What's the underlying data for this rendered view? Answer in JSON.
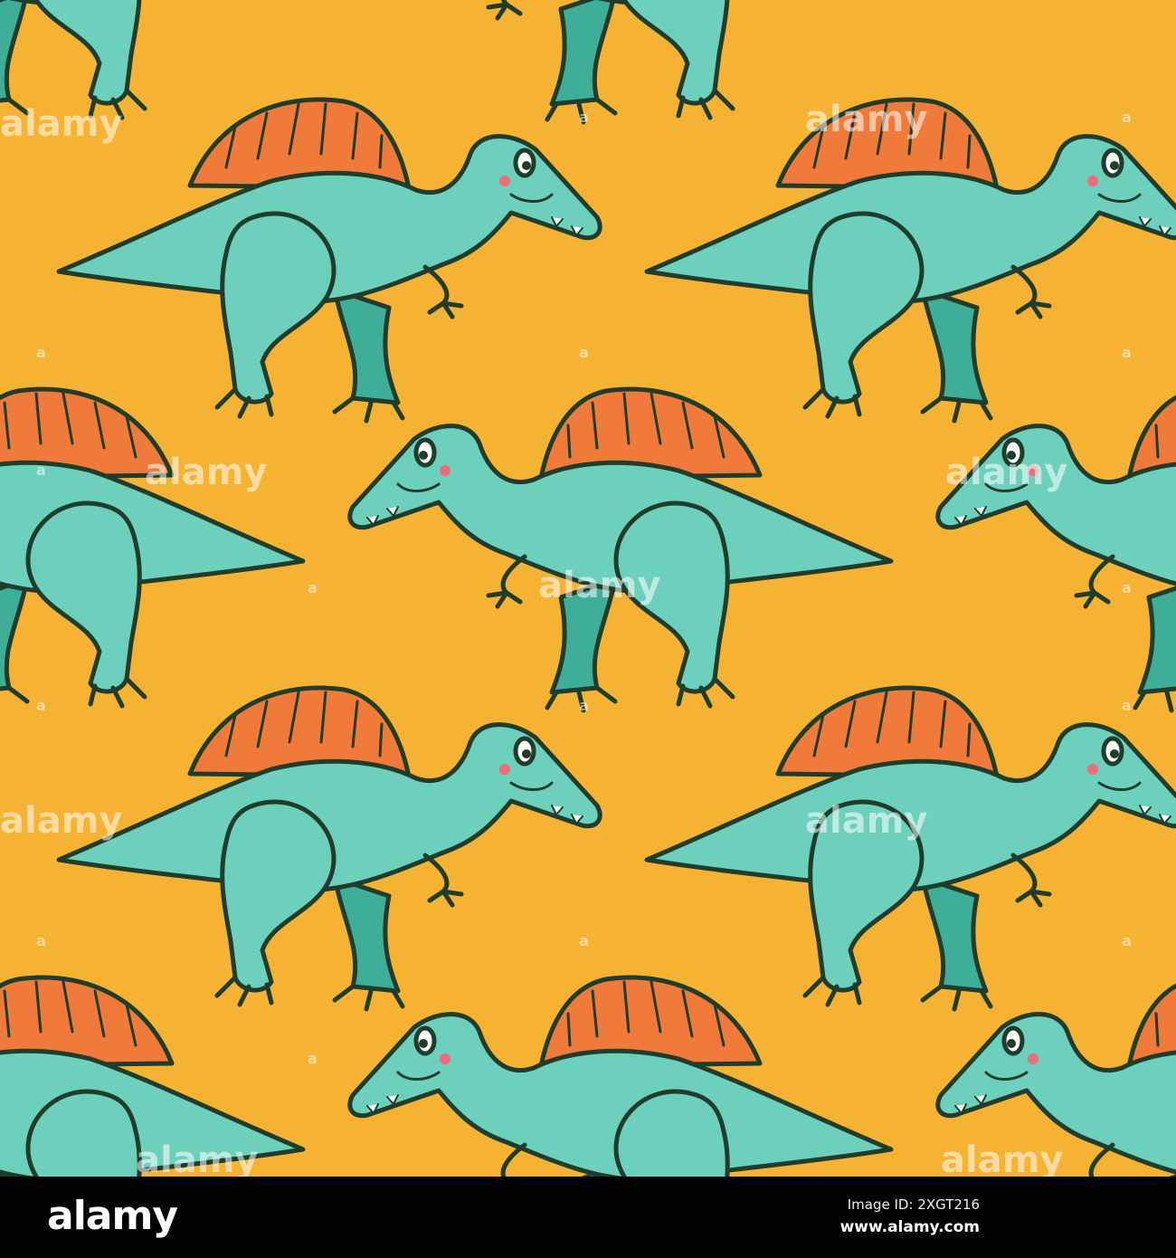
{
  "colors": {
    "background": "#f6b232",
    "dino_body": "#6dd0bd",
    "dino_shade": "#3fae99",
    "sail": "#f07a3a",
    "outline": "#1f3d2a"
  },
  "watermark": "alamy",
  "footer": {
    "logo": "alamy",
    "image_id": "Image ID: 2XGT216",
    "site": "www.alamy.com"
  }
}
